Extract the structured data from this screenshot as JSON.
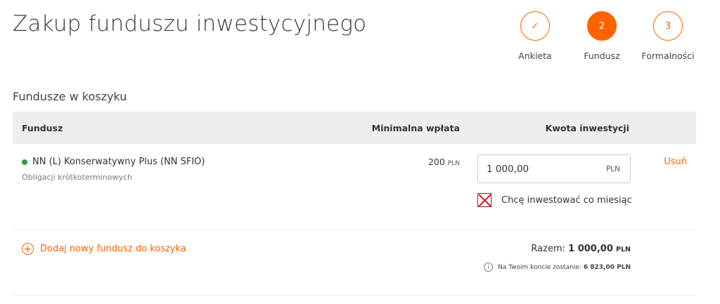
{
  "page": {
    "title": "Zakup funduszu inwestycyjnego"
  },
  "stepper": {
    "steps": [
      {
        "number": "✓",
        "label": "Ankieta",
        "state": "done"
      },
      {
        "number": "2",
        "label": "Fundusz",
        "state": "active"
      },
      {
        "number": "3",
        "label": "Formalności",
        "state": "pending"
      }
    ]
  },
  "cart": {
    "title": "Fundusze w koszyku",
    "headers": {
      "fund": "Fundusz",
      "min_payment": "Minimalna wpłata",
      "amount": "Kwota inwestycji"
    },
    "items": [
      {
        "name": "NN (L) Konserwatywny Plus (NN SFIO)",
        "category": "Obligacji krótkoterminowych",
        "min_payment": "200",
        "min_payment_currency": "PLN",
        "amount_value": "1 000,00",
        "amount_currency": "PLN",
        "monthly_label": "Chcę inwestować co miesiąc",
        "monthly_checked": false,
        "remove_label": "Usuń",
        "status_color": "#2c9a4b"
      }
    ],
    "add_fund_label": "Dodaj nowy fundusz do koszyka",
    "total_label": "Razem:",
    "total_value": "1 000,00",
    "total_currency": "PLN",
    "balance_label": "Na Twoim koncie zostanie:",
    "balance_value": "6 823,00 PLN"
  },
  "colors": {
    "accent": "#ff6200",
    "header_bg": "#eeeeee",
    "status_green": "#2c9a4b"
  }
}
